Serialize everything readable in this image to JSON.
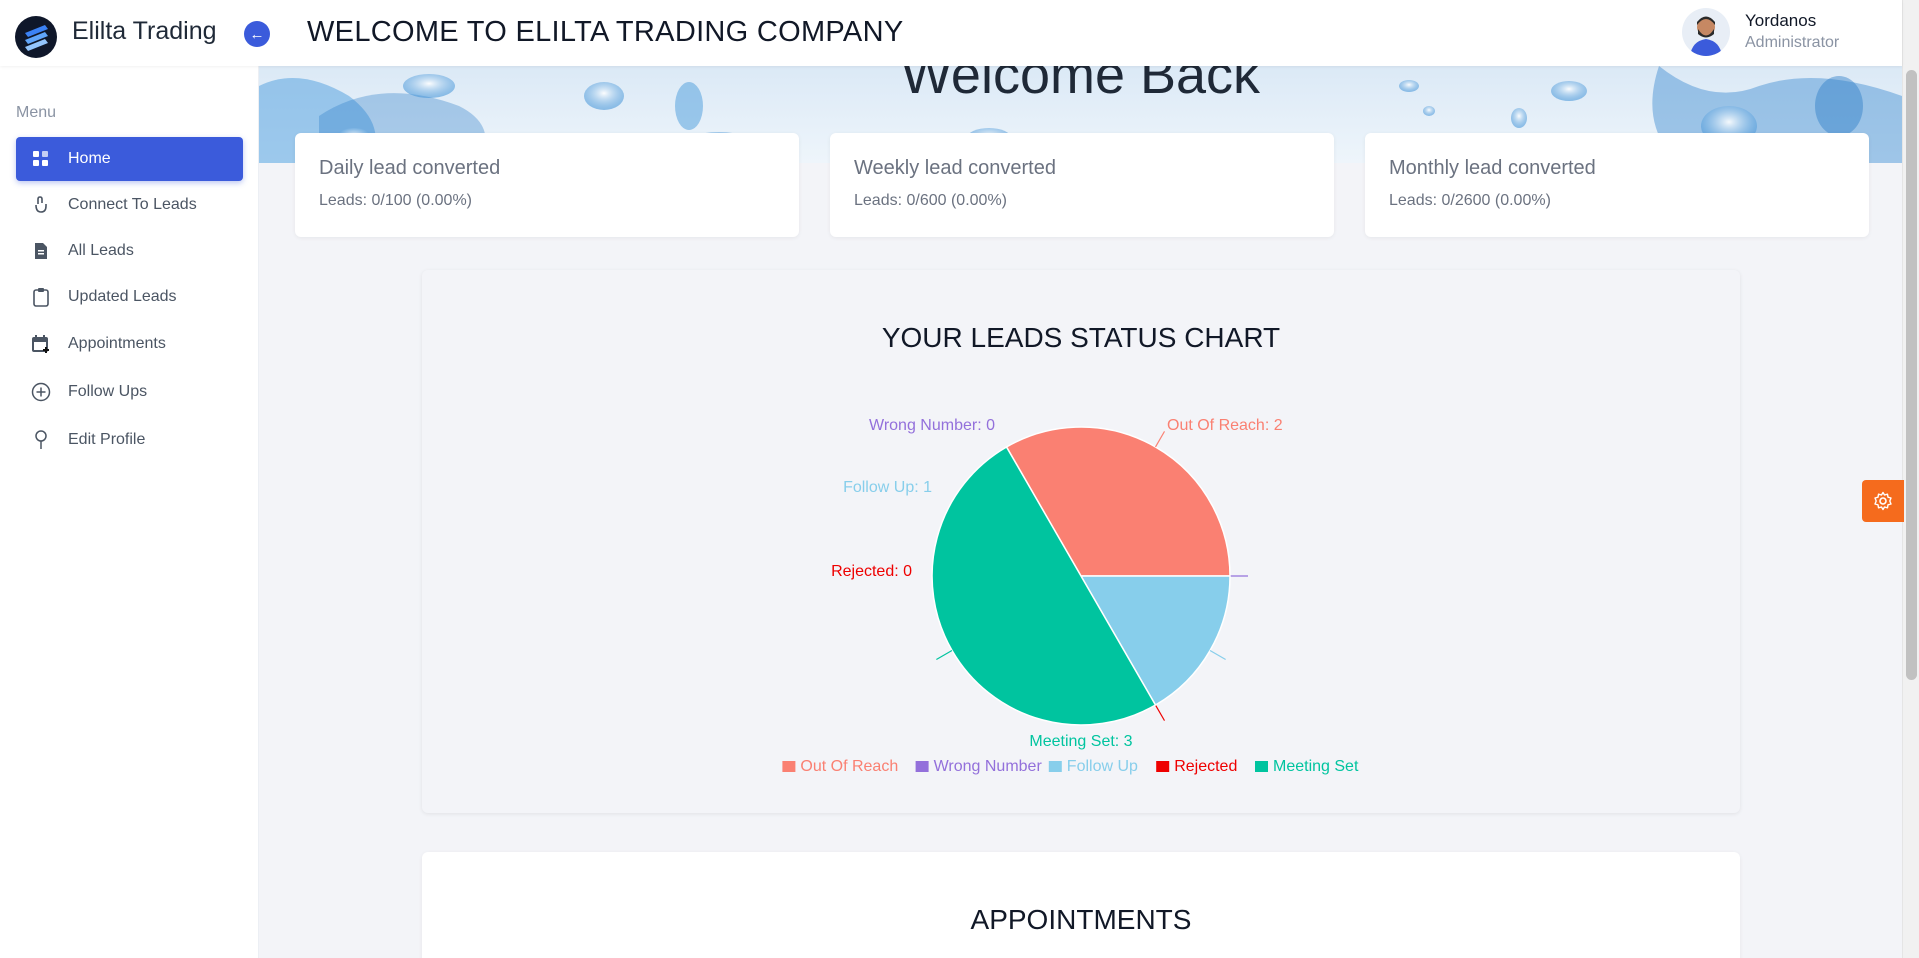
{
  "app": {
    "brand": "Elilta Trading",
    "heading": "WELCOME TO ELILTA TRADING COMPANY"
  },
  "user": {
    "name": "Yordanos",
    "role": "Administrator"
  },
  "sidebar": {
    "menu_title": "Menu",
    "items": [
      {
        "label": "Home",
        "icon": "grid-icon",
        "active": true
      },
      {
        "label": "Connect To Leads",
        "icon": "hand-icon"
      },
      {
        "label": "All Leads",
        "icon": "file-icon"
      },
      {
        "label": "Updated Leads",
        "icon": "clipboard-icon"
      },
      {
        "label": "Appointments",
        "icon": "calendar-plus-icon"
      },
      {
        "label": "Follow Ups",
        "icon": "plus-circle-icon"
      },
      {
        "label": "Edit Profile",
        "icon": "pin-icon"
      }
    ]
  },
  "hero": {
    "title": "Welcome Back"
  },
  "cards": [
    {
      "title": "Daily lead converted",
      "subtitle": "Leads: 0/100 (0.00%)"
    },
    {
      "title": "Weekly lead converted",
      "subtitle": "Leads: 0/600 (0.00%)"
    },
    {
      "title": "Monthly lead converted",
      "subtitle": "Leads: 0/2600 (0.00%)"
    }
  ],
  "chart": {
    "title": "YOUR LEADS STATUS CHART"
  },
  "appointments": {
    "title": "APPOINTMENTS"
  },
  "colors": {
    "accent": "#3b5bdb",
    "settings": "#f56b1d"
  },
  "chart_data": {
    "type": "pie",
    "title": "YOUR LEADS STATUS CHART",
    "legend_position": "bottom",
    "slices": [
      {
        "label": "Out Of Reach",
        "value": 2,
        "color": "#fa8072",
        "callout": "Out Of Reach: 2"
      },
      {
        "label": "Wrong Number",
        "value": 0,
        "color": "#9370db",
        "callout": "Wrong Number: 0"
      },
      {
        "label": "Follow Up",
        "value": 1,
        "color": "#87ceeb",
        "callout": "Follow Up: 1"
      },
      {
        "label": "Rejected",
        "value": 0,
        "color": "#ee0000",
        "callout": "Rejected: 0"
      },
      {
        "label": "Meeting Set",
        "value": 3,
        "color": "#00c49f",
        "callout": "Meeting Set: 3"
      }
    ]
  }
}
